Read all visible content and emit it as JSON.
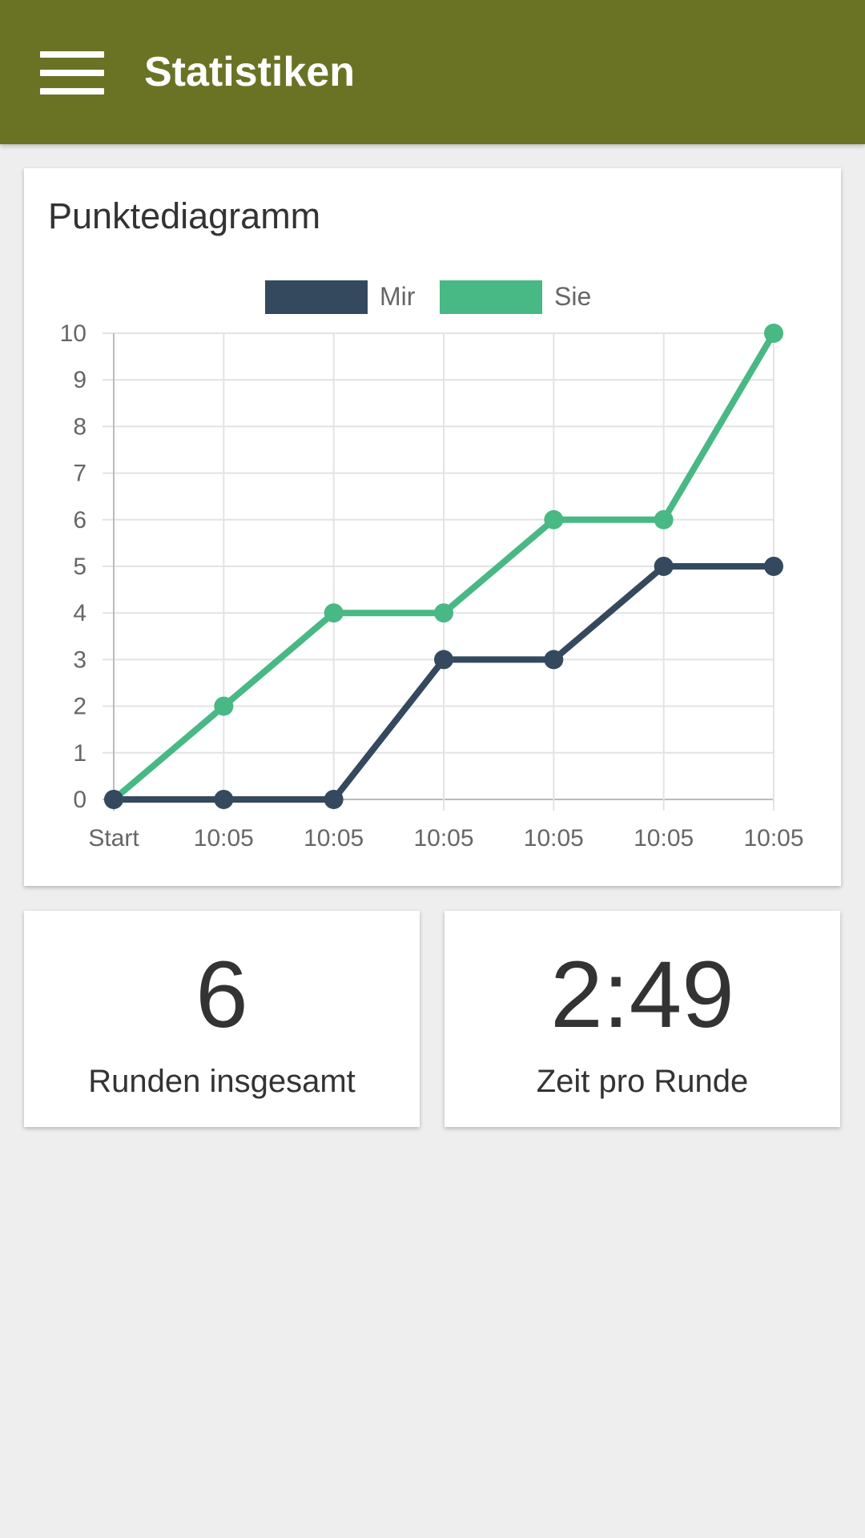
{
  "appbar": {
    "title": "Statistiken",
    "menu_icon": "hamburger-menu-icon",
    "background": "#6a7324"
  },
  "chart_card": {
    "title": "Punktediagramm"
  },
  "chart_data": {
    "type": "line",
    "categories": [
      "Start",
      "10:05",
      "10:05",
      "10:05",
      "10:05",
      "10:05",
      "10:05"
    ],
    "series": [
      {
        "name": "Mir",
        "color": "#34495e",
        "values": [
          0,
          0,
          0,
          3,
          3,
          5,
          5
        ]
      },
      {
        "name": "Sie",
        "color": "#48b884",
        "values": [
          0,
          2,
          4,
          4,
          6,
          6,
          10
        ]
      }
    ],
    "ylim": [
      0,
      10
    ],
    "yticks": [
      "0",
      "1",
      "2",
      "3",
      "4",
      "5",
      "6",
      "7",
      "8",
      "9",
      "10"
    ],
    "grid": true,
    "legend": "top-center"
  },
  "stats": [
    {
      "value": "6",
      "label": "Runden insgesamt"
    },
    {
      "value": "2:49",
      "label": "Zeit pro Runde"
    }
  ]
}
